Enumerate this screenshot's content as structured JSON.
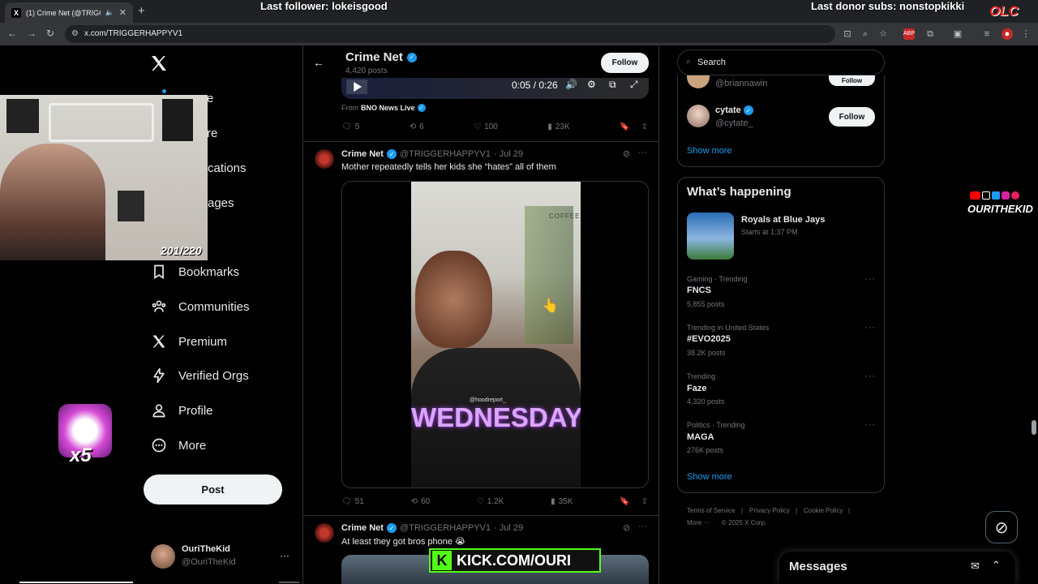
{
  "browser": {
    "tab_title": "(1) Crime Net (@TRIGGERH",
    "tab_favicon": "X",
    "url": "x.com/TRIGGERHAPPYV1"
  },
  "stream_overlay": {
    "last_follower": "Last follower: lokeisgood",
    "last_donor": "Last donor subs: nonstopkikki",
    "brand": "OLC",
    "webcam_count": "201/220",
    "badge_multiplier": "x5",
    "channel_name": "OURITHEKID",
    "kick_banner": "KICK.COM/OURI"
  },
  "sidebar": {
    "items": [
      {
        "label": "Bookmarks",
        "icon": "bookmark-icon"
      },
      {
        "label": "Communities",
        "icon": "communities-icon"
      },
      {
        "label": "Premium",
        "icon": "x-logo-icon"
      },
      {
        "label": "Verified Orgs",
        "icon": "lightning-icon"
      },
      {
        "label": "Profile",
        "icon": "person-icon"
      },
      {
        "label": "More",
        "icon": "more-circle-icon"
      }
    ],
    "partial_items": [
      "e",
      "re",
      "cations",
      "ages"
    ],
    "post_button": "Post",
    "account": {
      "name": "OuriTheKid",
      "handle": "@OuriTheKid"
    }
  },
  "header": {
    "name": "Crime Net",
    "posts": "4,420 posts",
    "follow": "Follow"
  },
  "video_controls": {
    "time": "0:05 / 0:26"
  },
  "from_line": {
    "prefix": "From",
    "source": "BNO News Live"
  },
  "tweets": [
    {
      "stats": {
        "replies": "5",
        "reposts": "6",
        "likes": "100",
        "views": "23K"
      }
    },
    {
      "name": "Crime Net",
      "handle": "@TRIGGERHAPPYV1",
      "date": "· Jul 29",
      "text": "Mother repeatedly tells her kids she “hates” all of them",
      "video_caption": "WEDNESDAY",
      "video_watermark": "@hoodreport_",
      "video_sign": "COFFEE",
      "stats": {
        "replies": "51",
        "reposts": "60",
        "likes": "1.2K",
        "views": "35K"
      }
    },
    {
      "name": "Crime Net",
      "handle": "@TRIGGERHAPPYV1",
      "date": "· Jul 29",
      "text": "At least they got bros phone 😭"
    }
  ],
  "right": {
    "search_placeholder": "Search",
    "who_to_follow": [
      {
        "handle": "@briannawin",
        "follow": "Follow"
      },
      {
        "name": "cytate",
        "handle": "@cytate_",
        "follow": "Follow"
      }
    ],
    "show_more_1": "Show more",
    "whats_happening_title": "What’s happening",
    "event": {
      "title": "Royals at Blue Jays",
      "subtitle": "Starts at 1:37 PM"
    },
    "trends": [
      {
        "meta": "Gaming · Trending",
        "name": "FNCS",
        "posts": "5,855 posts"
      },
      {
        "meta": "Trending in United States",
        "name": "#EVO2025",
        "posts": "38.2K posts"
      },
      {
        "meta": "Trending",
        "name": "Faze",
        "posts": "4,320 posts"
      },
      {
        "meta": "Politics · Trending",
        "name": "MAGA",
        "posts": "276K posts"
      }
    ],
    "show_more_2": "Show more",
    "footer": [
      "Terms of Service",
      "Privacy Policy",
      "Cookie Policy",
      "More ···",
      "© 2025 X Corp."
    ],
    "footer_sep": "|"
  },
  "messages": {
    "title": "Messages"
  }
}
